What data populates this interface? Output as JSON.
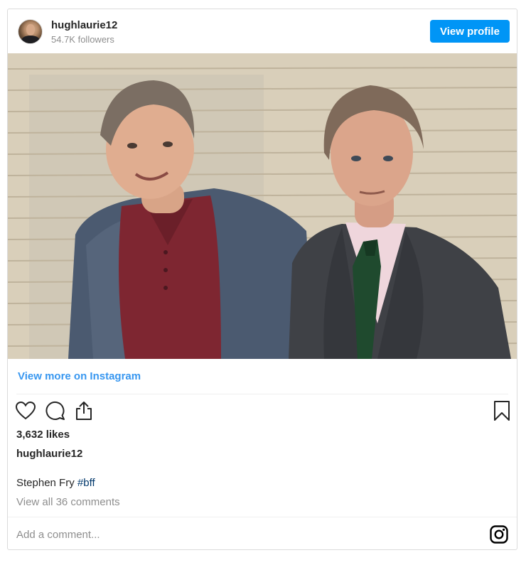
{
  "header": {
    "username": "hughlaurie12",
    "followers": "54.7K followers",
    "view_profile_label": "View profile"
  },
  "photo": {
    "description_icon": "photo-of-two-men"
  },
  "links": {
    "view_more": "View more on Instagram"
  },
  "actions": {
    "icons": [
      "heart-icon",
      "comment-icon",
      "share-icon",
      "bookmark-icon"
    ]
  },
  "stats": {
    "likes": "3,632 likes"
  },
  "caption": {
    "username": "hughlaurie12",
    "text": "Stephen Fry",
    "hashtag": "#bff",
    "view_comments": "View all 36 comments"
  },
  "comment": {
    "placeholder": "Add a comment..."
  },
  "colors": {
    "accent": "#0095f6",
    "link": "#3897f0",
    "hashtag": "#00376b",
    "muted": "#8e8e8e"
  }
}
